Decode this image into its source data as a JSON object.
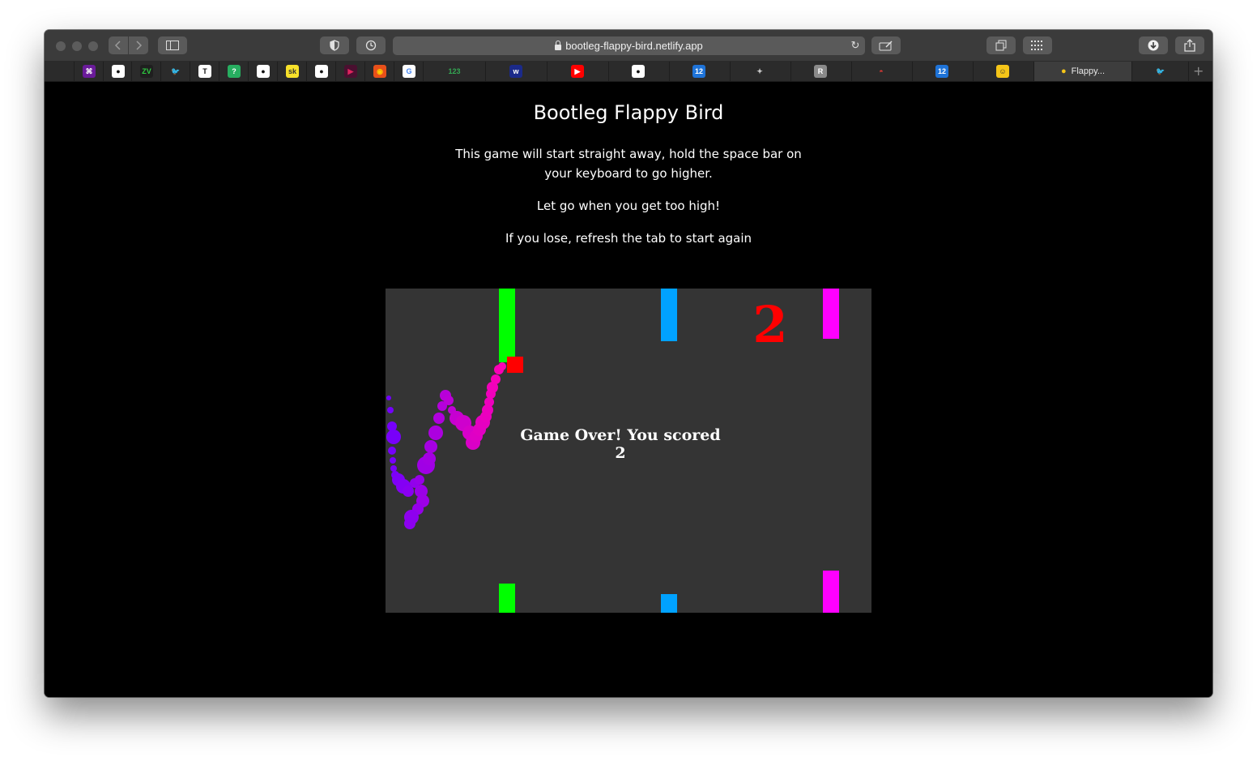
{
  "browser": {
    "url": "bootleg-flappy-bird.netlify.app",
    "active_tab_label": "Flappy...",
    "favorites": [
      {
        "icon": "apple-icon",
        "glyph": "",
        "bg": "transparent",
        "fg": "#bdbdbd"
      },
      {
        "icon": "grid-app-icon",
        "glyph": "⌘",
        "bg": "#6a1b9a",
        "fg": "#ffffff"
      },
      {
        "icon": "github-icon",
        "glyph": "●",
        "bg": "#ffffff",
        "fg": "#111111"
      },
      {
        "icon": "zv-icon",
        "glyph": "ZV",
        "bg": "#1f1f1f",
        "fg": "#2ecc40"
      },
      {
        "icon": "twitter-icon",
        "glyph": "🐦",
        "bg": "transparent",
        "fg": "#1da1f2"
      },
      {
        "icon": "nyt-icon",
        "glyph": "T",
        "bg": "#ffffff",
        "fg": "#111111"
      },
      {
        "icon": "question-icon",
        "glyph": "?",
        "bg": "#27ae60",
        "fg": "#ffffff"
      },
      {
        "icon": "github-icon",
        "glyph": "●",
        "bg": "#ffffff",
        "fg": "#111111"
      },
      {
        "icon": "yellow-app-icon",
        "glyph": "sk",
        "bg": "#f7e12a",
        "fg": "#333333"
      },
      {
        "icon": "github-icon",
        "glyph": "●",
        "bg": "#ffffff",
        "fg": "#111111"
      },
      {
        "icon": "play-icon",
        "glyph": "▶",
        "bg": "#4a1030",
        "fg": "#e0245e"
      },
      {
        "icon": "firefox-icon",
        "glyph": "◉",
        "bg": "#e8501a",
        "fg": "#ffcc00"
      },
      {
        "icon": "google-icon",
        "glyph": "G",
        "bg": "#ffffff",
        "fg": "#4285f4"
      },
      {
        "icon": "numbers-123-icon",
        "glyph": "123",
        "bg": "transparent",
        "fg": "#34a853"
      },
      {
        "icon": "webflow-icon",
        "glyph": "w",
        "bg": "#1b2a8a",
        "fg": "#ffffff"
      },
      {
        "icon": "youtube-icon",
        "glyph": "▶",
        "bg": "#ff0000",
        "fg": "#ffffff"
      },
      {
        "icon": "github-icon",
        "glyph": "●",
        "bg": "#ffffff",
        "fg": "#111111"
      },
      {
        "icon": "numbers-icon",
        "glyph": "12",
        "bg": "#1e73d8",
        "fg": "#ffffff"
      },
      {
        "icon": "runner-icon",
        "glyph": "✦",
        "bg": "transparent",
        "fg": "#c8c8c8"
      },
      {
        "icon": "r-icon",
        "glyph": "R",
        "bg": "#8a8a8a",
        "fg": "#ffffff"
      },
      {
        "icon": "pokeball-icon",
        "glyph": "◓",
        "bg": "transparent",
        "fg": "#e53935"
      },
      {
        "icon": "numbers-icon",
        "glyph": "12",
        "bg": "#1e73d8",
        "fg": "#ffffff"
      },
      {
        "icon": "emoji-face-icon",
        "glyph": "☺",
        "bg": "#f5c518",
        "fg": "#333333"
      },
      {
        "icon": "bird-icon",
        "glyph": "🐤",
        "bg": "transparent",
        "fg": "#f5c518"
      },
      {
        "icon": "bird-green-icon",
        "glyph": "🐦",
        "bg": "transparent",
        "fg": "#2ecc71"
      }
    ]
  },
  "page": {
    "title": "Bootleg Flappy Bird",
    "instructions_line1": "This game will start straight away, hold the space bar on",
    "instructions_line2": "your keyboard to go higher.",
    "instructions_2": "Let go when you get too high!",
    "instructions_3": "If you lose, refresh the tab to start again"
  },
  "game": {
    "score": "2",
    "game_over_text": "Game Over! You scored 2",
    "colors": {
      "background": "#343434",
      "pipe_1": "#00ff00",
      "pipe_2": "#00a2ff",
      "pipe_3": "#ff00ff",
      "bird": "#ff0000",
      "score": "#ff0000"
    }
  }
}
